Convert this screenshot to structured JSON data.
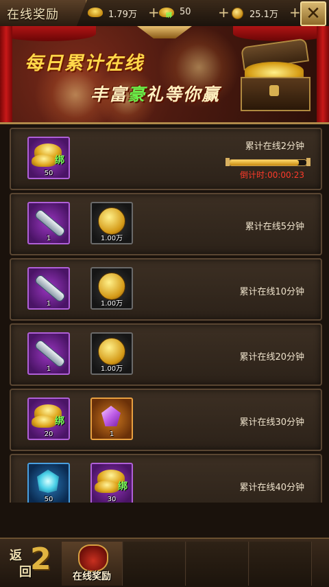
{
  "window": {
    "title": "在线奖励"
  },
  "resources": {
    "ingot": "1.79万",
    "bound_ingot": "50",
    "bound_tag": "绑",
    "gold": "25.1万",
    "plus": "+"
  },
  "banner": {
    "line1": "每日累计在线",
    "line2_a": "丰富",
    "line2_b": "豪",
    "line2_c": "礼等你赢"
  },
  "rewards": [
    {
      "requirement": "累计在线2分钟",
      "progress": 0.9,
      "countdown": "倒计时:00:00:23",
      "items": [
        {
          "icon": "gold-ingot-icon",
          "frame": "purple",
          "qty": "50",
          "bound": "绑"
        }
      ]
    },
    {
      "requirement": "累计在线5分钟",
      "items": [
        {
          "icon": "scroll-icon",
          "frame": "purple",
          "qty": "1"
        },
        {
          "icon": "gold-coin-icon",
          "frame": "dark",
          "qty": "1.00万"
        }
      ]
    },
    {
      "requirement": "累计在线10分钟",
      "items": [
        {
          "icon": "scroll-icon",
          "frame": "purple",
          "qty": "1"
        },
        {
          "icon": "gold-coin-icon",
          "frame": "dark",
          "qty": "1.00万"
        }
      ]
    },
    {
      "requirement": "累计在线20分钟",
      "items": [
        {
          "icon": "scroll-icon",
          "frame": "purple",
          "qty": "1"
        },
        {
          "icon": "gold-coin-icon",
          "frame": "dark",
          "qty": "1.00万"
        }
      ]
    },
    {
      "requirement": "累计在线30分钟",
      "items": [
        {
          "icon": "gold-ingot-icon",
          "frame": "purple",
          "qty": "20",
          "bound": "绑"
        },
        {
          "icon": "purple-gem-icon",
          "frame": "orange",
          "qty": "1"
        }
      ]
    },
    {
      "requirement": "累计在线40分钟",
      "items": [
        {
          "icon": "crystal-icon",
          "frame": "blue",
          "qty": "50"
        },
        {
          "icon": "gold-ingot-icon",
          "frame": "purple",
          "qty": "30",
          "bound": "绑"
        }
      ]
    }
  ],
  "bottom": {
    "back_1": "返",
    "back_2": "回",
    "tab_label": "在线奖励"
  },
  "colors": {
    "countdown": "#ff3a2a",
    "bound": "#7cff5a",
    "accent_gold": "#e0b440"
  }
}
